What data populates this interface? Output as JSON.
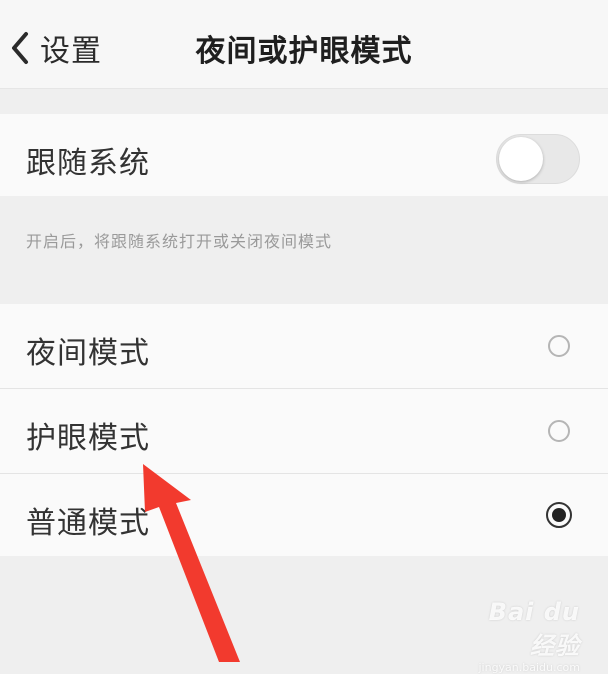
{
  "nav": {
    "back_label": "设置",
    "title": "夜间或护眼模式"
  },
  "follow_system": {
    "label": "跟随系统",
    "enabled": false,
    "hint": "开启后，将跟随系统打开或关闭夜间模式"
  },
  "modes": [
    {
      "label": "夜间模式",
      "selected": false
    },
    {
      "label": "护眼模式",
      "selected": false
    },
    {
      "label": "普通模式",
      "selected": true
    }
  ],
  "watermark": {
    "main": "Bai du 经验",
    "sub": "jingyan.baidu.com"
  },
  "colors": {
    "arrow": "#f23a2e",
    "background": "#efefef",
    "row_background": "#fafafa"
  }
}
